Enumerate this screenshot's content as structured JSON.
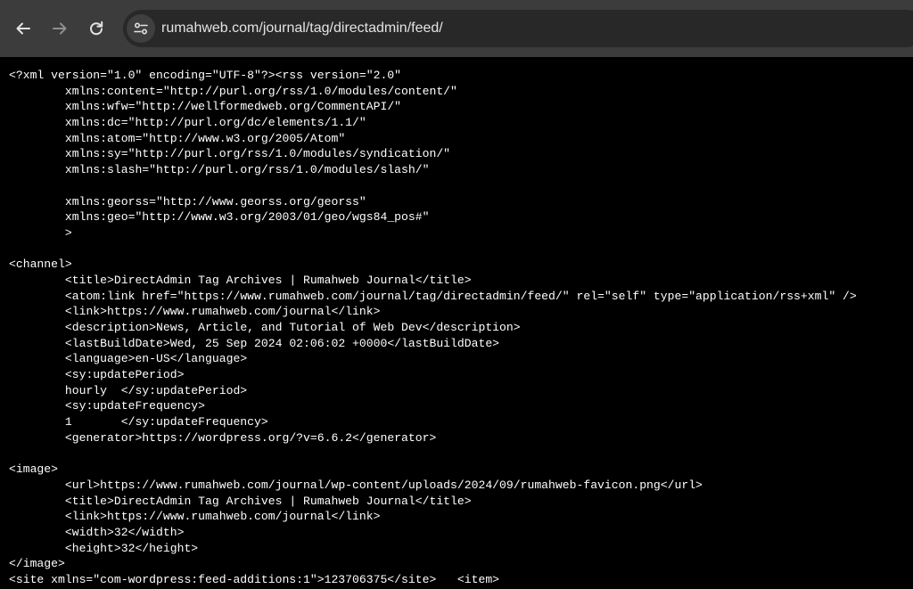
{
  "browser": {
    "url": "rumahweb.com/journal/tag/directadmin/feed/"
  },
  "colors": {
    "toolbar": "#3c3c3c",
    "omnibox": "#282828",
    "page_background": "#000000",
    "text": "#ffffff"
  },
  "icons": {
    "back": "arrow-left-icon",
    "forward": "arrow-right-icon",
    "reload": "reload-icon",
    "site_info": "tune-icon"
  },
  "source_lines": [
    "<?xml version=\"1.0\" encoding=\"UTF-8\"?><rss version=\"2.0\"",
    "\txmlns:content=\"http://purl.org/rss/1.0/modules/content/\"",
    "\txmlns:wfw=\"http://wellformedweb.org/CommentAPI/\"",
    "\txmlns:dc=\"http://purl.org/dc/elements/1.1/\"",
    "\txmlns:atom=\"http://www.w3.org/2005/Atom\"",
    "\txmlns:sy=\"http://purl.org/rss/1.0/modules/syndication/\"",
    "\txmlns:slash=\"http://purl.org/rss/1.0/modules/slash/\"",
    "",
    "\txmlns:georss=\"http://www.georss.org/georss\"",
    "\txmlns:geo=\"http://www.w3.org/2003/01/geo/wgs84_pos#\"",
    "\t>",
    "",
    "<channel>",
    "\t<title>DirectAdmin Tag Archives | Rumahweb Journal</title>",
    "\t<atom:link href=\"https://www.rumahweb.com/journal/tag/directadmin/feed/\" rel=\"self\" type=\"application/rss+xml\" />",
    "\t<link>https://www.rumahweb.com/journal</link>",
    "\t<description>News, Article, and Tutorial of Web Dev</description>",
    "\t<lastBuildDate>Wed, 25 Sep 2024 02:06:02 +0000</lastBuildDate>",
    "\t<language>en-US</language>",
    "\t<sy:updatePeriod>",
    "\thourly\t</sy:updatePeriod>",
    "\t<sy:updateFrequency>",
    "\t1\t</sy:updateFrequency>",
    "\t<generator>https://wordpress.org/?v=6.6.2</generator>",
    "",
    "<image>",
    "\t<url>https://www.rumahweb.com/journal/wp-content/uploads/2024/09/rumahweb-favicon.png</url>",
    "\t<title>DirectAdmin Tag Archives | Rumahweb Journal</title>",
    "\t<link>https://www.rumahweb.com/journal</link>",
    "\t<width>32</width>",
    "\t<height>32</height>",
    "</image>",
    "<site xmlns=\"com-wordpress:feed-additions:1\">123706375</site>\t<item>"
  ]
}
